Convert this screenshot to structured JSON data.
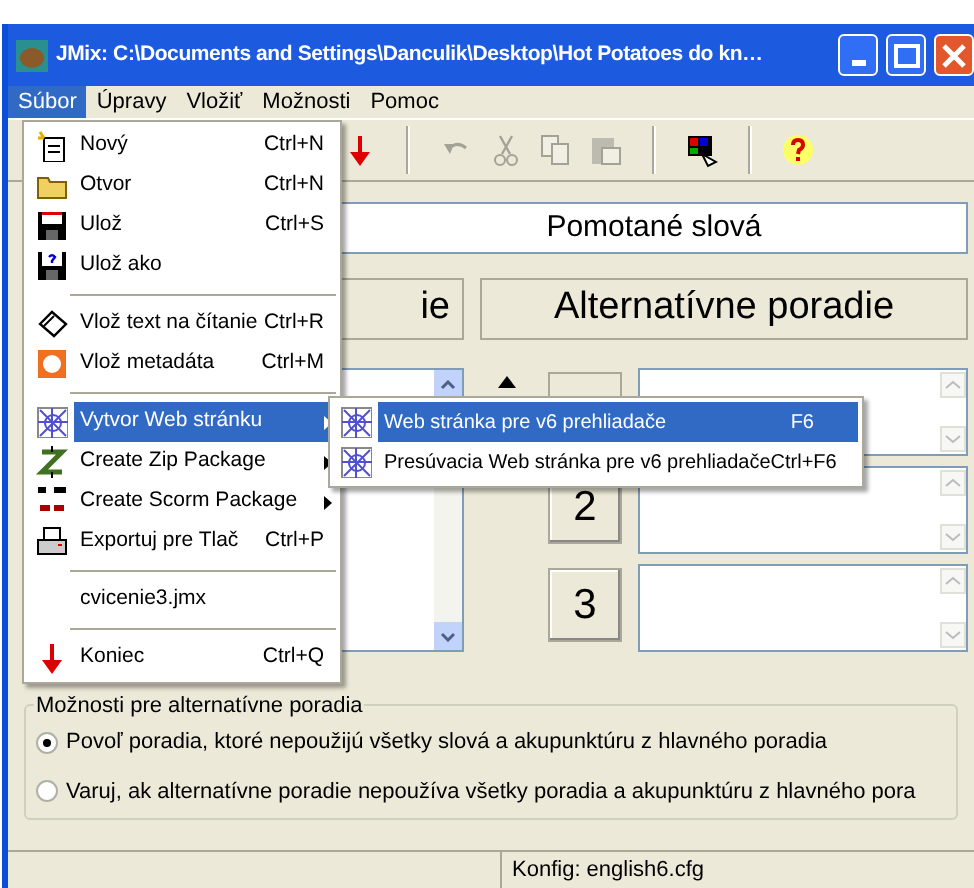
{
  "window": {
    "title": "JMix: C:\\Documents and Settings\\Danculik\\Desktop\\Hot Potatoes do kn…"
  },
  "menu_bar": [
    {
      "label": "Súbor",
      "selected": true
    },
    {
      "label": "Úpravy",
      "selected": false
    },
    {
      "label": "Vložiť",
      "selected": false
    },
    {
      "label": "Možnosti",
      "selected": false
    },
    {
      "label": "Pomoc",
      "selected": false
    }
  ],
  "toolbar": [
    {
      "kind": "arrow",
      "disabled": false
    },
    {
      "kind": "separator"
    },
    {
      "kind": "undo",
      "disabled": true
    },
    {
      "kind": "cut",
      "disabled": true
    },
    {
      "kind": "copy",
      "disabled": true
    },
    {
      "kind": "paste",
      "disabled": true
    },
    {
      "kind": "separator"
    },
    {
      "kind": "palette",
      "disabled": false
    },
    {
      "kind": "separator"
    },
    {
      "kind": "help",
      "disabled": false
    }
  ],
  "title_field": {
    "value": "Pomotané slová"
  },
  "columns": [
    {
      "heading": "ie"
    },
    {
      "heading": "Alternatívne poradie"
    }
  ],
  "alternatives": [
    {
      "kind": "covered"
    },
    {
      "kind": "numbered",
      "number": "2"
    },
    {
      "kind": "numbered",
      "number": "3"
    }
  ],
  "options_group": {
    "title": "Možnosti pre alternatívne poradia",
    "options": [
      {
        "label": "Povoľ poradia, ktoré nepoužijú všetky slová a akupunktúru z hlavného poradia",
        "selected": true
      },
      {
        "label": "Varuj, ak alternatívne poradie nepoužíva všetky poradia a akupunktúru z hlavného pora",
        "selected": false
      }
    ]
  },
  "status_bar": {
    "config": "Konfig: english6.cfg"
  },
  "file_menu": [
    {
      "kind": "item",
      "label": "Nový",
      "shortcut": "Ctrl+N",
      "selected": false
    },
    {
      "kind": "item",
      "label": "Otvor",
      "shortcut": "Ctrl+N",
      "selected": false
    },
    {
      "kind": "item",
      "label": "Ulož",
      "shortcut": "Ctrl+S",
      "selected": false
    },
    {
      "kind": "item",
      "label": "Ulož ako",
      "selected": false
    },
    {
      "kind": "separator"
    },
    {
      "kind": "item",
      "label": "Vlož text na čítanie",
      "shortcut": "Ctrl+R",
      "selected": false
    },
    {
      "kind": "item",
      "label": "Vlož metadáta",
      "shortcut": "Ctrl+M",
      "selected": false
    },
    {
      "kind": "separator"
    },
    {
      "kind": "submenu",
      "label": "Vytvor Web stránku",
      "selected": true
    },
    {
      "kind": "submenu",
      "label": "Create Zip Package",
      "selected": false
    },
    {
      "kind": "submenu",
      "label": "Create Scorm Package",
      "selected": false
    },
    {
      "kind": "item",
      "label": "Exportuj pre Tlač",
      "shortcut": "Ctrl+P",
      "selected": false
    },
    {
      "kind": "separator"
    },
    {
      "kind": "item",
      "label": "cvicenie3.jmx",
      "selected": false
    },
    {
      "kind": "separator"
    },
    {
      "kind": "item",
      "label": "Koniec",
      "shortcut": "Ctrl+Q",
      "selected": false
    }
  ],
  "web_submenu": [
    {
      "label": "Web stránka pre v6 prehliadače",
      "shortcut": "F6",
      "selected": true
    },
    {
      "label": "Presúvacia Web stránka pre v6 prehliadače",
      "shortcut": "Ctrl+F6",
      "selected": false
    }
  ]
}
